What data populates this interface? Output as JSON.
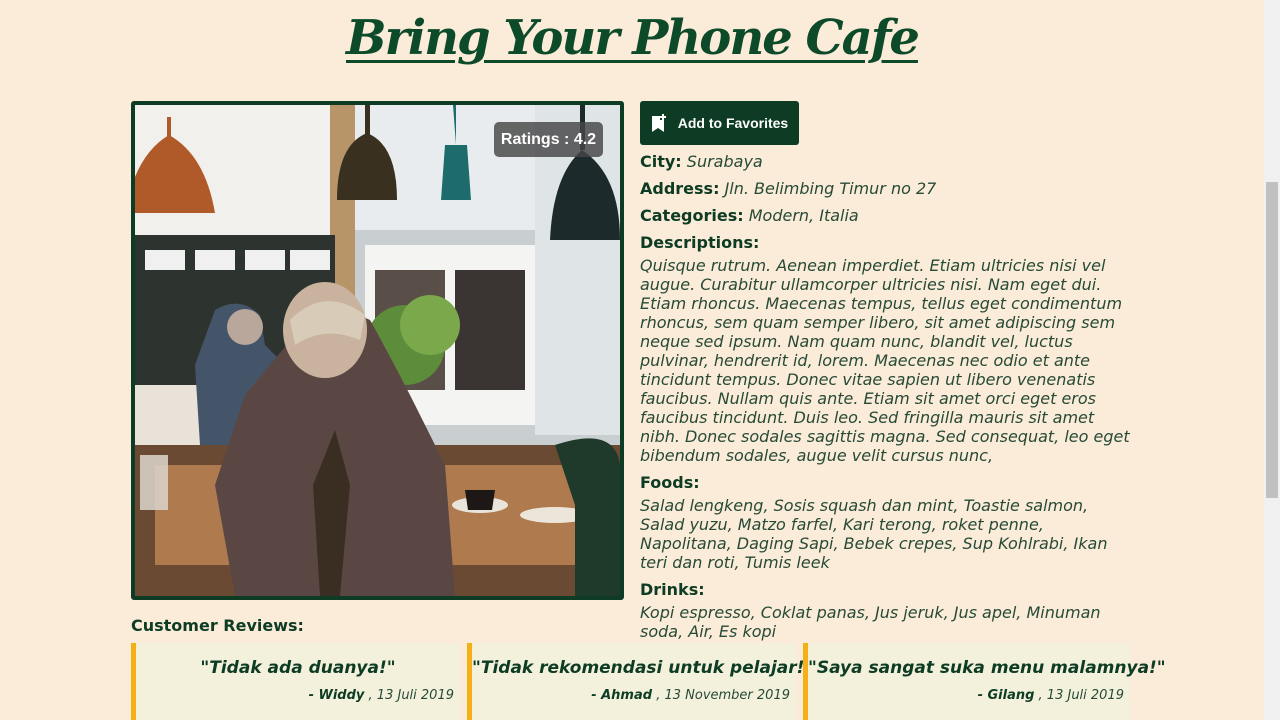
{
  "page": {
    "title": "Bring Your Phone Cafe"
  },
  "photo": {
    "rating_label": "Ratings : 4.2"
  },
  "actions": {
    "favorite_label": "Add to Favorites"
  },
  "details": {
    "city_label": "City:",
    "city": "Surabaya",
    "address_label": "Address:",
    "address": "Jln. Belimbing Timur no 27",
    "categories_label": "Categories:",
    "categories": "Modern, Italia",
    "descriptions_label": "Descriptions:",
    "description": "Quisque rutrum. Aenean imperdiet. Etiam ultricies nisi vel augue. Curabitur ullamcorper ultricies nisi. Nam eget dui. Etiam rhoncus. Maecenas tempus, tellus eget condimentum rhoncus, sem quam semper libero, sit amet adipiscing sem neque sed ipsum. Nam quam nunc, blandit vel, luctus pulvinar, hendrerit id, lorem. Maecenas nec odio et ante tincidunt tempus. Donec vitae sapien ut libero venenatis faucibus. Nullam quis ante. Etiam sit amet orci eget eros faucibus tincidunt. Duis leo. Sed fringilla mauris sit amet nibh. Donec sodales sagittis magna. Sed consequat, leo eget bibendum sodales, augue velit cursus nunc,",
    "foods_label": "Foods:",
    "foods": "Salad lengkeng, Sosis squash dan mint, Toastie salmon, Salad yuzu, Matzo farfel, Kari terong, roket penne, Napolitana, Daging Sapi, Bebek crepes, Sup Kohlrabi, Ikan teri dan roti, Tumis leek",
    "drinks_label": "Drinks:",
    "drinks": "Kopi espresso, Coklat panas, Jus jeruk, Jus apel, Minuman soda, Air, Es kopi"
  },
  "reviews": {
    "title": "Customer Reviews:",
    "items": [
      {
        "quote": "\"Tidak ada duanya!\"",
        "author": "- Widdy",
        "date": ", 13 Juli 2019"
      },
      {
        "quote": "\"Tidak rekomendasi untuk pelajar!\"",
        "author": "- Ahmad",
        "date": ", 13 November 2019"
      },
      {
        "quote": "\"Saya sangat suka menu malamnya!\"",
        "author": "- Gilang",
        "date": ", 13 Juli 2019"
      }
    ]
  },
  "colors": {
    "background": "#fbecd9",
    "primary": "#0d3b23",
    "accent": "#f5b015",
    "card": "#f3f1dc"
  },
  "icons": {
    "favorite": "bookmark-plus-icon"
  }
}
